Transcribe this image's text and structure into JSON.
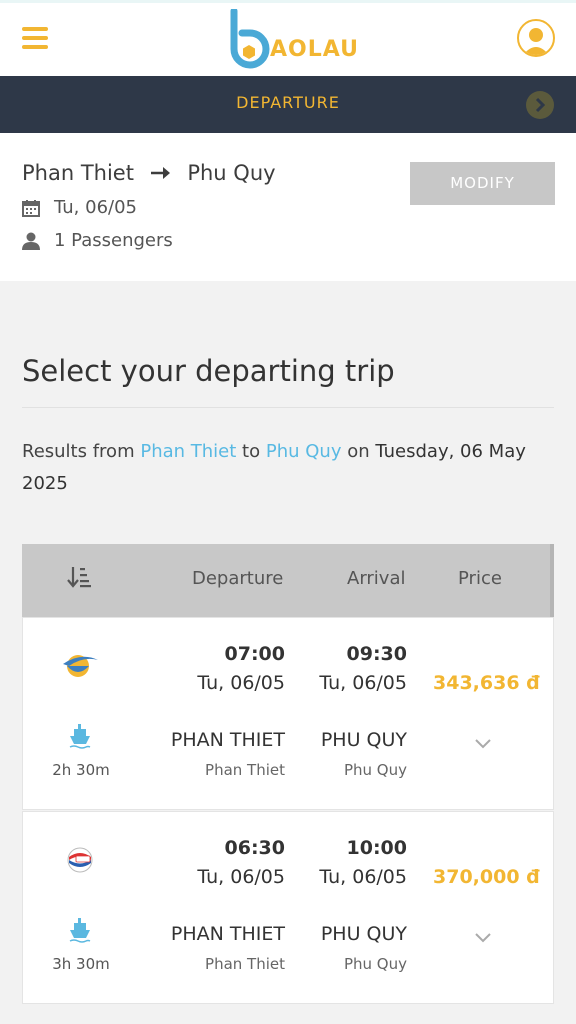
{
  "header": {
    "logo_text": "AOLAU",
    "menu_icon": "hamburger-menu-icon",
    "user_icon": "user-avatar-icon",
    "brand_color": "#f2b632"
  },
  "departure_bar": {
    "title": "DEPARTURE",
    "next_icon": "chevron-right-icon"
  },
  "summary": {
    "from": "Phan Thiet",
    "to": "Phu Quy",
    "date": "Tu, 06/05",
    "passengers": "1 Passengers",
    "modify_label": "MODIFY"
  },
  "section": {
    "title": "Select your departing trip",
    "results_prefix": "Results from",
    "results_from": "Phan Thiet",
    "results_to_word": "to",
    "results_to": "Phu Quy",
    "results_on": "on",
    "results_date": "Tuesday, 06 May 2025"
  },
  "table": {
    "headers": {
      "departure": "Departure",
      "arrival": "Arrival",
      "price": "Price"
    },
    "sort_icon": "sort-descending-icon"
  },
  "trips": [
    {
      "operator_icon": "airline-swoosh-logo-icon",
      "dep_time": "07:00",
      "dep_date": "Tu, 06/05",
      "arr_time": "09:30",
      "arr_date": "Tu, 06/05",
      "price": "343,636 đ",
      "duration": "2h 30m",
      "dep_port": "PHAN THIET",
      "dep_city": "Phan Thiet",
      "arr_port": "PHU QUY",
      "arr_city": "Phu Quy"
    },
    {
      "operator_icon": "ferry-company-logo-icon",
      "dep_time": "06:30",
      "dep_date": "Tu, 06/05",
      "arr_time": "10:00",
      "arr_date": "Tu, 06/05",
      "price": "370,000 đ",
      "duration": "3h 30m",
      "dep_port": "PHAN THIET",
      "dep_city": "Phan Thiet",
      "arr_port": "PHU QUY",
      "arr_city": "Phu Quy"
    }
  ]
}
